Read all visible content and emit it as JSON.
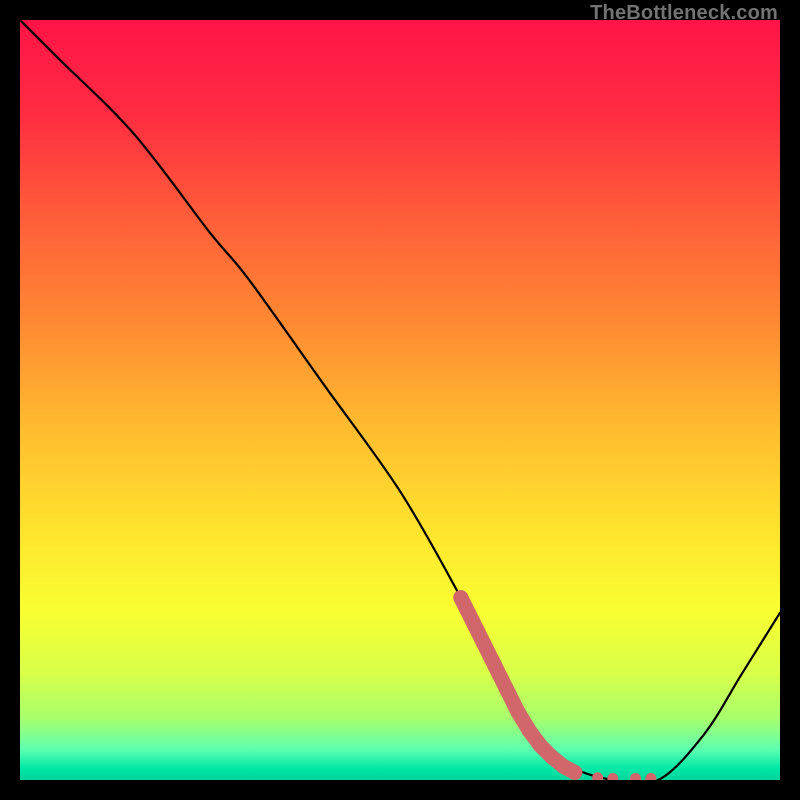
{
  "watermark": "TheBottleneck.com",
  "chart_data": {
    "type": "line",
    "title": "",
    "xlabel": "",
    "ylabel": "",
    "xlim": [
      0,
      100
    ],
    "ylim": [
      0,
      100
    ],
    "grid": false,
    "series": [
      {
        "name": "curve",
        "x": [
          0,
          5,
          15,
          25,
          30,
          40,
          50,
          58,
          62,
          68,
          72,
          78,
          84,
          90,
          95,
          100
        ],
        "y": [
          100,
          95,
          85,
          72,
          66,
          52,
          38,
          24,
          16,
          6,
          2,
          0,
          0,
          6,
          14,
          22
        ]
      }
    ],
    "markers": {
      "name": "highlight",
      "color": "#d1676a",
      "points": [
        {
          "x": 58.0,
          "y": 24.0
        },
        {
          "x": 59.5,
          "y": 21.0
        },
        {
          "x": 61.0,
          "y": 18.0
        },
        {
          "x": 62.5,
          "y": 15.0
        },
        {
          "x": 64.0,
          "y": 12.0
        },
        {
          "x": 65.5,
          "y": 9.0
        },
        {
          "x": 67.0,
          "y": 6.5
        },
        {
          "x": 68.5,
          "y": 4.5
        },
        {
          "x": 70.0,
          "y": 3.0
        },
        {
          "x": 71.5,
          "y": 1.8
        },
        {
          "x": 73.0,
          "y": 1.0
        },
        {
          "x": 76.0,
          "y": 0.3
        },
        {
          "x": 78.0,
          "y": 0.2
        },
        {
          "x": 81.0,
          "y": 0.2
        },
        {
          "x": 83.0,
          "y": 0.2
        }
      ]
    },
    "gradient_stops": [
      {
        "offset": 0.0,
        "color": "#ff1447"
      },
      {
        "offset": 0.12,
        "color": "#ff2b42"
      },
      {
        "offset": 0.25,
        "color": "#ff5a3a"
      },
      {
        "offset": 0.4,
        "color": "#ff8a33"
      },
      {
        "offset": 0.55,
        "color": "#ffc02f"
      },
      {
        "offset": 0.68,
        "color": "#ffe62e"
      },
      {
        "offset": 0.78,
        "color": "#f8ff31"
      },
      {
        "offset": 0.86,
        "color": "#d8ff4a"
      },
      {
        "offset": 0.92,
        "color": "#a6ff6e"
      },
      {
        "offset": 0.96,
        "color": "#5dffb0"
      },
      {
        "offset": 0.985,
        "color": "#00e8a6"
      },
      {
        "offset": 1.0,
        "color": "#00d49c"
      }
    ]
  }
}
